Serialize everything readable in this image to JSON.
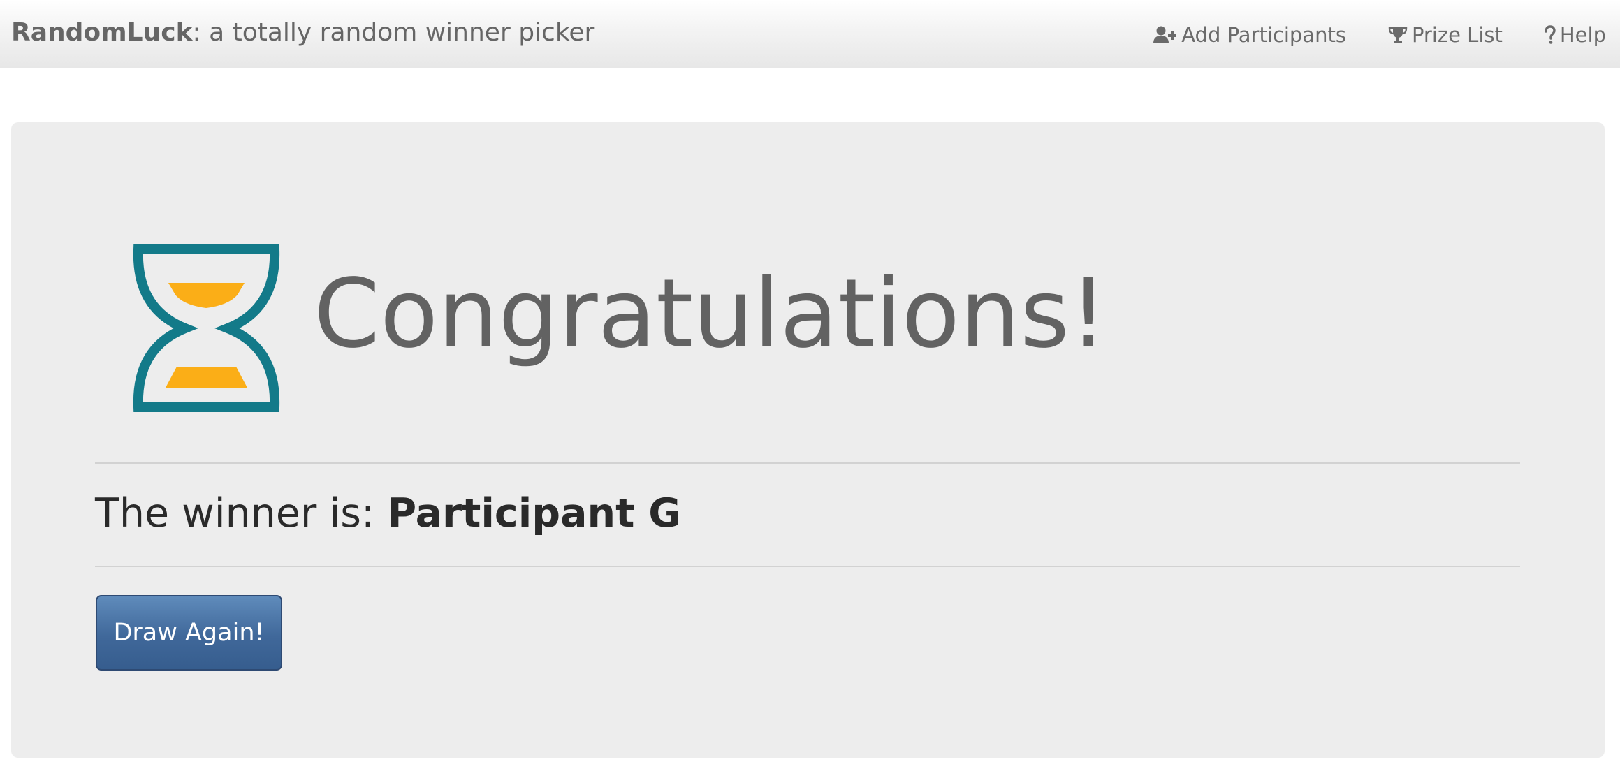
{
  "navbar": {
    "brand_name": "RandomLuck",
    "brand_tagline": ": a totally random winner picker",
    "links": [
      {
        "label": "Add Participants",
        "icon": "user-plus-icon"
      },
      {
        "label": "Prize List",
        "icon": "trophy-icon"
      },
      {
        "label": "Help",
        "icon": "question-icon"
      }
    ]
  },
  "main": {
    "hero_icon": "hourglass-icon",
    "title": "Congratulations!",
    "winner_prefix": "The winner is: ",
    "winner_name": "Participant G",
    "draw_again_label": "Draw Again!"
  },
  "colors": {
    "hourglass_frame": "#137a89",
    "hourglass_sand": "#fbae17",
    "button": "#40689a",
    "panel": "#ededed"
  }
}
